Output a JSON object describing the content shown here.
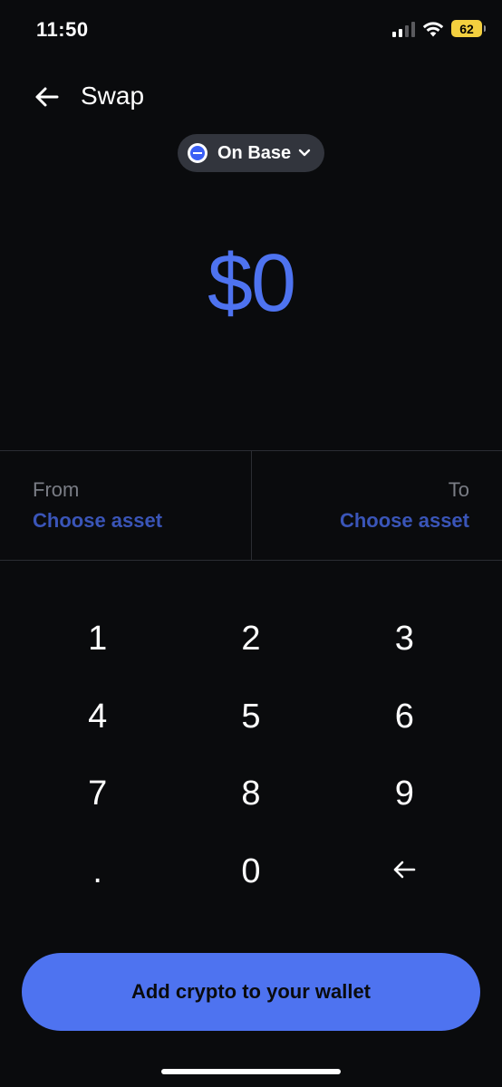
{
  "status_bar": {
    "time": "11:50",
    "battery_level": "62"
  },
  "header": {
    "title": "Swap"
  },
  "network": {
    "label": "On Base"
  },
  "amount": {
    "display": "$0"
  },
  "from": {
    "label": "From",
    "value": "Choose asset"
  },
  "to": {
    "label": "To",
    "value": "Choose asset"
  },
  "keypad": {
    "keys": [
      "1",
      "2",
      "3",
      "4",
      "5",
      "6",
      "7",
      "8",
      "9",
      ".",
      "0"
    ]
  },
  "cta": {
    "label": "Add crypto to your wallet"
  },
  "colors": {
    "background": "#0a0b0d",
    "accent": "#4e73f0",
    "muted_link": "#3a55b8",
    "chip_bg": "#32353d"
  },
  "icons": {
    "back": "arrow-left-icon",
    "network": "base-logo-icon",
    "dropdown": "chevron-down-icon",
    "backspace": "arrow-left-icon"
  }
}
